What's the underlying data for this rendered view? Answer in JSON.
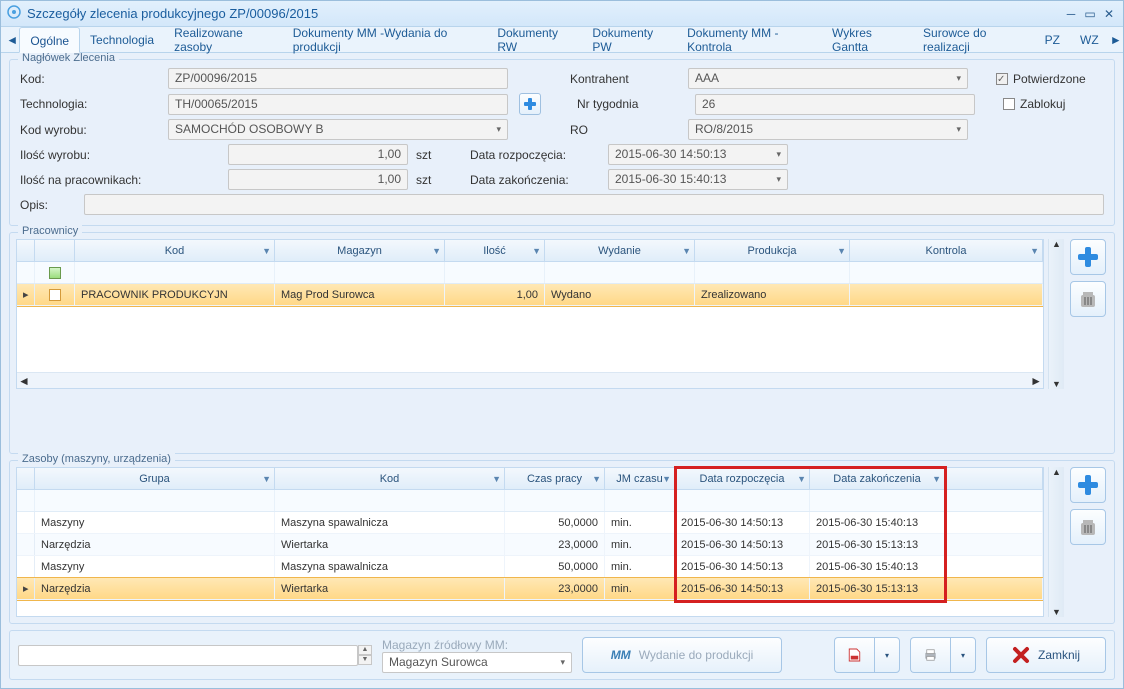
{
  "title": "Szczegóły zlecenia produkcyjnego ZP/00096/2015",
  "tabs": [
    "Ogólne",
    "Technologia",
    "Realizowane zasoby",
    "Dokumenty MM -Wydania do produkcji",
    "Dokumenty RW",
    "Dokumenty PW",
    "Dokumenty MM - Kontrola",
    "Wykres Gantta",
    "Surowce do realizacji",
    "PZ",
    "WZ"
  ],
  "groupboxes": {
    "naglowek": "Nagłówek Zlecenia",
    "pracownicy": "Pracownicy",
    "zasoby": "Zasoby (maszyny, urządzenia)"
  },
  "header": {
    "labels": {
      "kod": "Kod:",
      "technologia": "Technologia:",
      "kod_wyrobu": "Kod wyrobu:",
      "ilosc_wyrobu": "Ilość wyrobu:",
      "ilosc_prac": "Ilość na pracownikach:",
      "opis": "Opis:",
      "kontrahent": "Kontrahent",
      "nr_tyg": "Nr tygodnia",
      "ro": "RO",
      "data_rozp": "Data rozpoczęcia:",
      "data_zak": "Data zakończenia:",
      "potw": "Potwierdzone",
      "zablokuj": "Zablokuj"
    },
    "values": {
      "kod": "ZP/00096/2015",
      "technologia": "TH/00065/2015",
      "kod_wyrobu": "SAMOCHÓD OSOBOWY B",
      "ilosc_wyrobu": "1,00",
      "ilosc_prac": "1,00",
      "opis": "",
      "kontrahent": "AAA",
      "nr_tyg": "26",
      "ro": "RO/8/2015",
      "data_rozp": "2015-06-30 14:50:13",
      "data_zak": "2015-06-30 15:40:13",
      "szt": "szt"
    }
  },
  "pracownicy": {
    "cols": [
      "",
      "Kod",
      "Magazyn",
      "Ilość",
      "Wydanie",
      "Produkcja",
      "Kontrola"
    ],
    "rows": [
      {
        "kod": "PRACOWNIK PRODUKCYJN",
        "magazyn": "Mag Prod Surowca",
        "ilosc": "1,00",
        "wydanie": "Wydano",
        "produkcja": "Zrealizowano",
        "kontrola": ""
      }
    ]
  },
  "zasoby": {
    "cols": [
      "Grupa",
      "Kod",
      "Czas pracy",
      "JM czasu",
      "Data rozpoczęcia",
      "Data zakończenia"
    ],
    "rows": [
      {
        "grupa": "Maszyny",
        "kod": "Maszyna spawalnicza",
        "czas": "50,0000",
        "jm": "min.",
        "dr": "2015-06-30 14:50:13",
        "dz": "2015-06-30 15:40:13"
      },
      {
        "grupa": "Narzędzia",
        "kod": "Wiertarka",
        "czas": "23,0000",
        "jm": "min.",
        "dr": "2015-06-30 14:50:13",
        "dz": "2015-06-30 15:13:13"
      },
      {
        "grupa": "Maszyny",
        "kod": "Maszyna spawalnicza",
        "czas": "50,0000",
        "jm": "min.",
        "dr": "2015-06-30 14:50:13",
        "dz": "2015-06-30 15:40:13"
      },
      {
        "grupa": "Narzędzia",
        "kod": "Wiertarka",
        "czas": "23,0000",
        "jm": "min.",
        "dr": "2015-06-30 14:50:13",
        "dz": "2015-06-30 15:13:13"
      }
    ]
  },
  "footer": {
    "mag_label": "Magazyn źródłowy MM:",
    "mag_value": "Magazyn Surowca",
    "mm": "MM",
    "wyd_btn": "Wydanie do produkcji",
    "zamknij": "Zamknij"
  }
}
